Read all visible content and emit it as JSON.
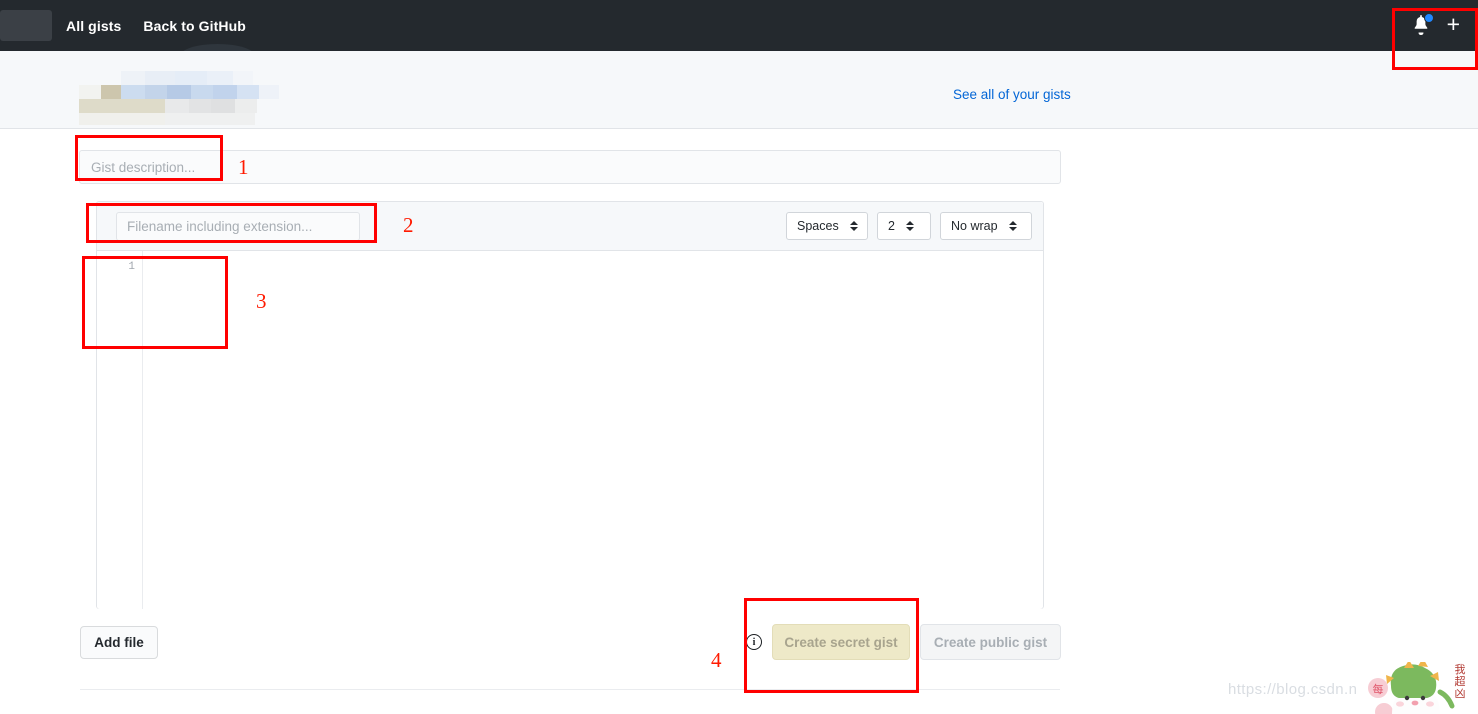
{
  "topnav": {
    "logo": "github-logo",
    "links": [
      {
        "label": "All gists",
        "name": "nav-all-gists"
      },
      {
        "label": "Back to GitHub",
        "name": "nav-back-to-github"
      }
    ],
    "notifications_icon": "bell-icon",
    "create_new_icon": "plus-icon"
  },
  "gist_header": {
    "owner_name_redacted": "",
    "see_all_link": "See all of your gists"
  },
  "form": {
    "description_placeholder": "Gist description...",
    "description_value": "",
    "file": {
      "filename_placeholder": "Filename including extension...",
      "filename_value": "",
      "indent_mode": "Spaces",
      "indent_size": "2",
      "wrap_mode": "No wrap",
      "line_numbers": [
        "1"
      ],
      "code_value": ""
    },
    "add_file_label": "Add file",
    "info_icon_glyph": "i",
    "create_secret_label": "Create secret gist",
    "create_public_label": "Create public gist"
  },
  "annotations": [
    {
      "number": "1",
      "target": "gist-description-field"
    },
    {
      "number": "2",
      "target": "filename-field"
    },
    {
      "number": "3",
      "target": "code-editor-area"
    },
    {
      "number": "4",
      "target": "create-secret-gist-button"
    }
  ],
  "watermark": {
    "url": "https://blog.csdn.n",
    "vertical_text": "我超凶"
  },
  "colors": {
    "nav_bg": "#24292e",
    "header_bg": "#f6f8fa",
    "link_blue": "#0366d6",
    "annotation_red": "#ff0000",
    "secret_btn_bg": "#eee9c8",
    "notification_dot": "#2188ff"
  }
}
